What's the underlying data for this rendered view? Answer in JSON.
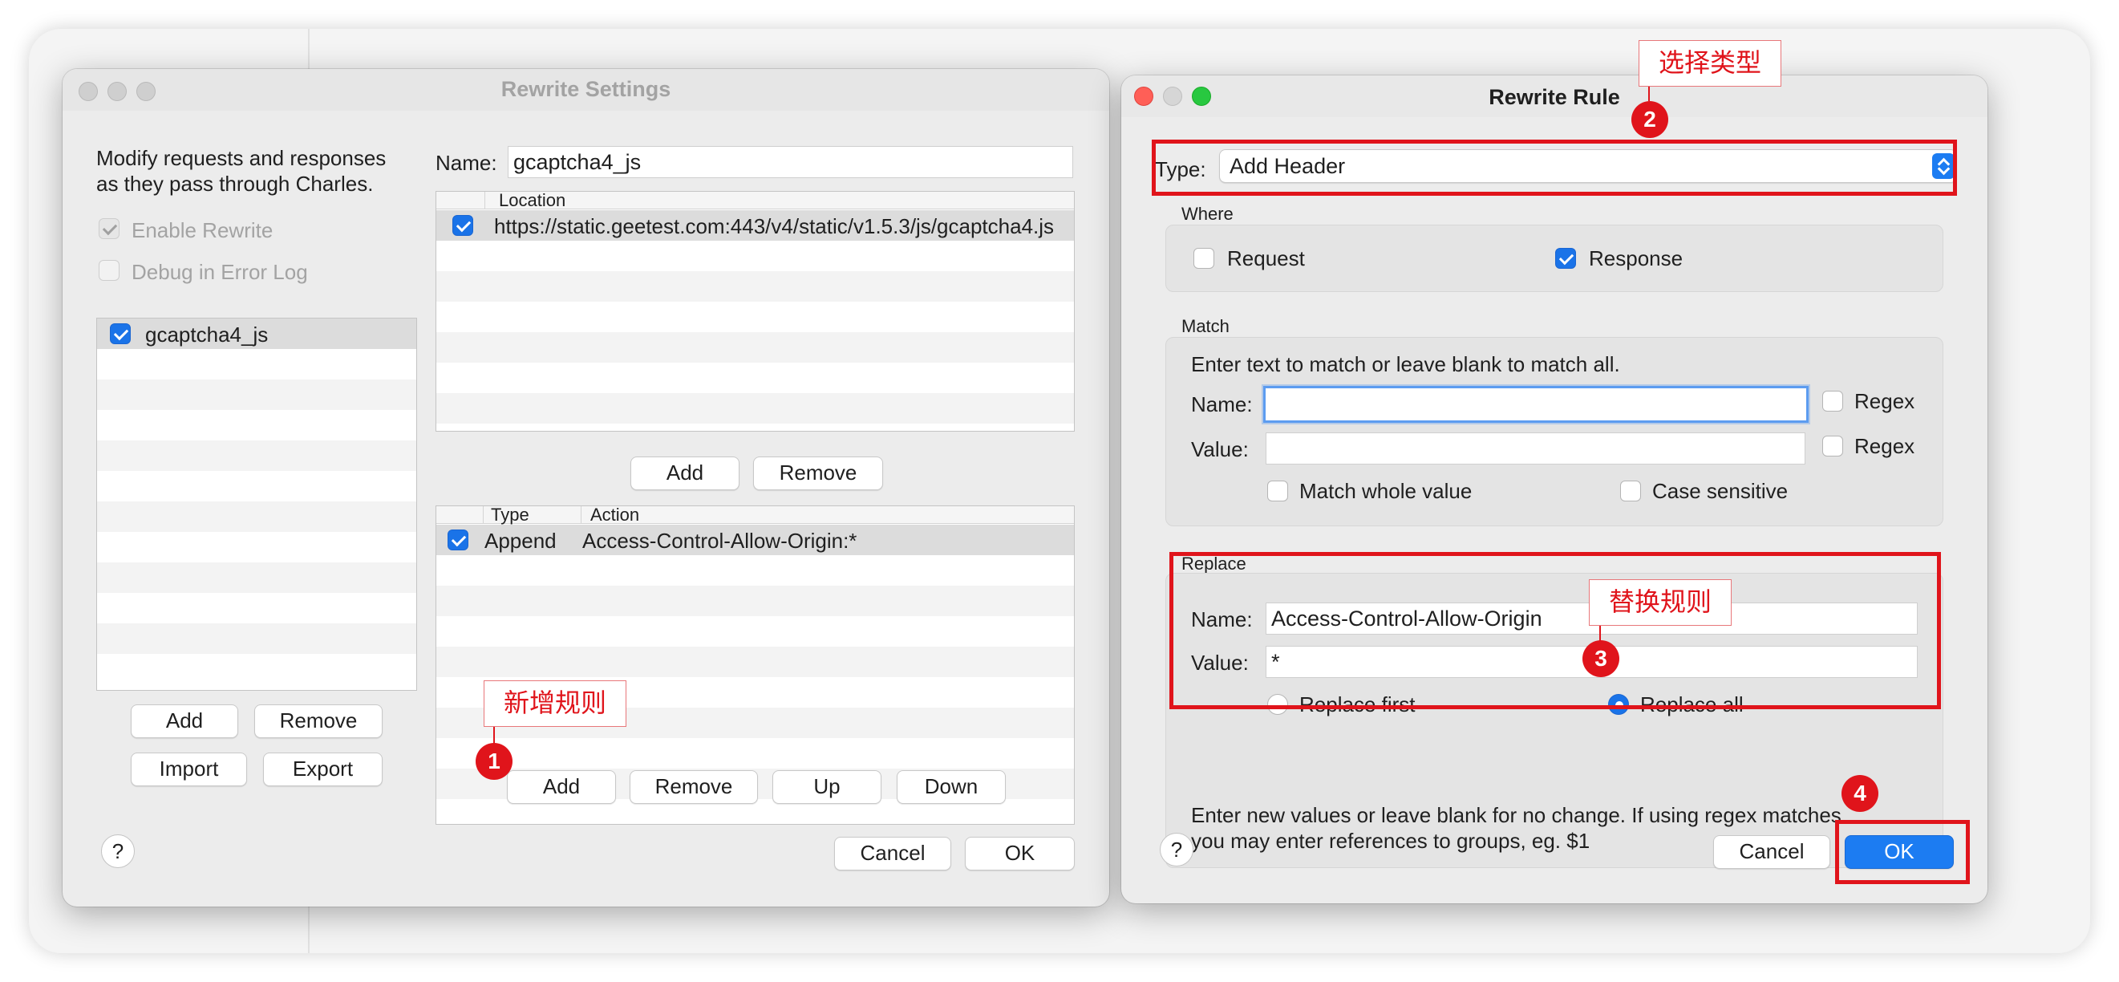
{
  "settings": {
    "title": "Rewrite Settings",
    "description_line1": "Modify requests and responses",
    "description_line2": "as they pass through Charles.",
    "enable_rewrite_label": "Enable Rewrite",
    "debug_label": "Debug in Error Log",
    "sets": [
      {
        "name": "gcaptcha4_js",
        "enabled": true
      }
    ],
    "buttons": {
      "add": "Add",
      "remove": "Remove",
      "import": "Import",
      "export": "Export"
    },
    "name_label": "Name:",
    "name_value": "gcaptcha4_js",
    "locations": {
      "header": "Location",
      "rows": [
        "https://static.geetest.com:443/v4/static/v1.5.3/js/gcaptcha4.js"
      ],
      "add": "Add",
      "remove": "Remove"
    },
    "rules": {
      "headers": {
        "type": "Type",
        "action": "Action"
      },
      "rows": [
        {
          "type": "Append",
          "action": "Access-Control-Allow-Origin:*"
        }
      ],
      "add": "Add",
      "remove": "Remove",
      "up": "Up",
      "down": "Down"
    },
    "help": "?",
    "cancel": "Cancel",
    "ok": "OK"
  },
  "rule": {
    "title": "Rewrite Rule",
    "type_label": "Type:",
    "type_value": "Add Header",
    "where": {
      "label": "Where",
      "request": "Request",
      "response": "Response"
    },
    "match": {
      "label": "Match",
      "hint": "Enter text to match or leave blank to match all.",
      "name_label": "Name:",
      "name_value": "",
      "value_label": "Value:",
      "value_value": "",
      "regex": "Regex",
      "whole_value": "Match whole value",
      "case_sensitive": "Case sensitive"
    },
    "replace": {
      "label": "Replace",
      "name_label": "Name:",
      "name_value": "Access-Control-Allow-Origin",
      "value_label": "Value:",
      "value_value": "*",
      "replace_first": "Replace first",
      "replace_all": "Replace all",
      "hint_line1": "Enter new values or leave blank for no change. If using regex matches",
      "hint_line2": "you may enter references to groups, eg. $1"
    },
    "help": "?",
    "cancel": "Cancel",
    "ok": "OK"
  },
  "annotations": {
    "one": {
      "num": "1",
      "text": "新增规则"
    },
    "two": {
      "num": "2",
      "text": "选择类型"
    },
    "three": {
      "num": "3",
      "text": "替换规则"
    },
    "four": {
      "num": "4"
    }
  },
  "colors": {
    "annotation": "#e0141b",
    "accent": "#1c7cf2"
  }
}
